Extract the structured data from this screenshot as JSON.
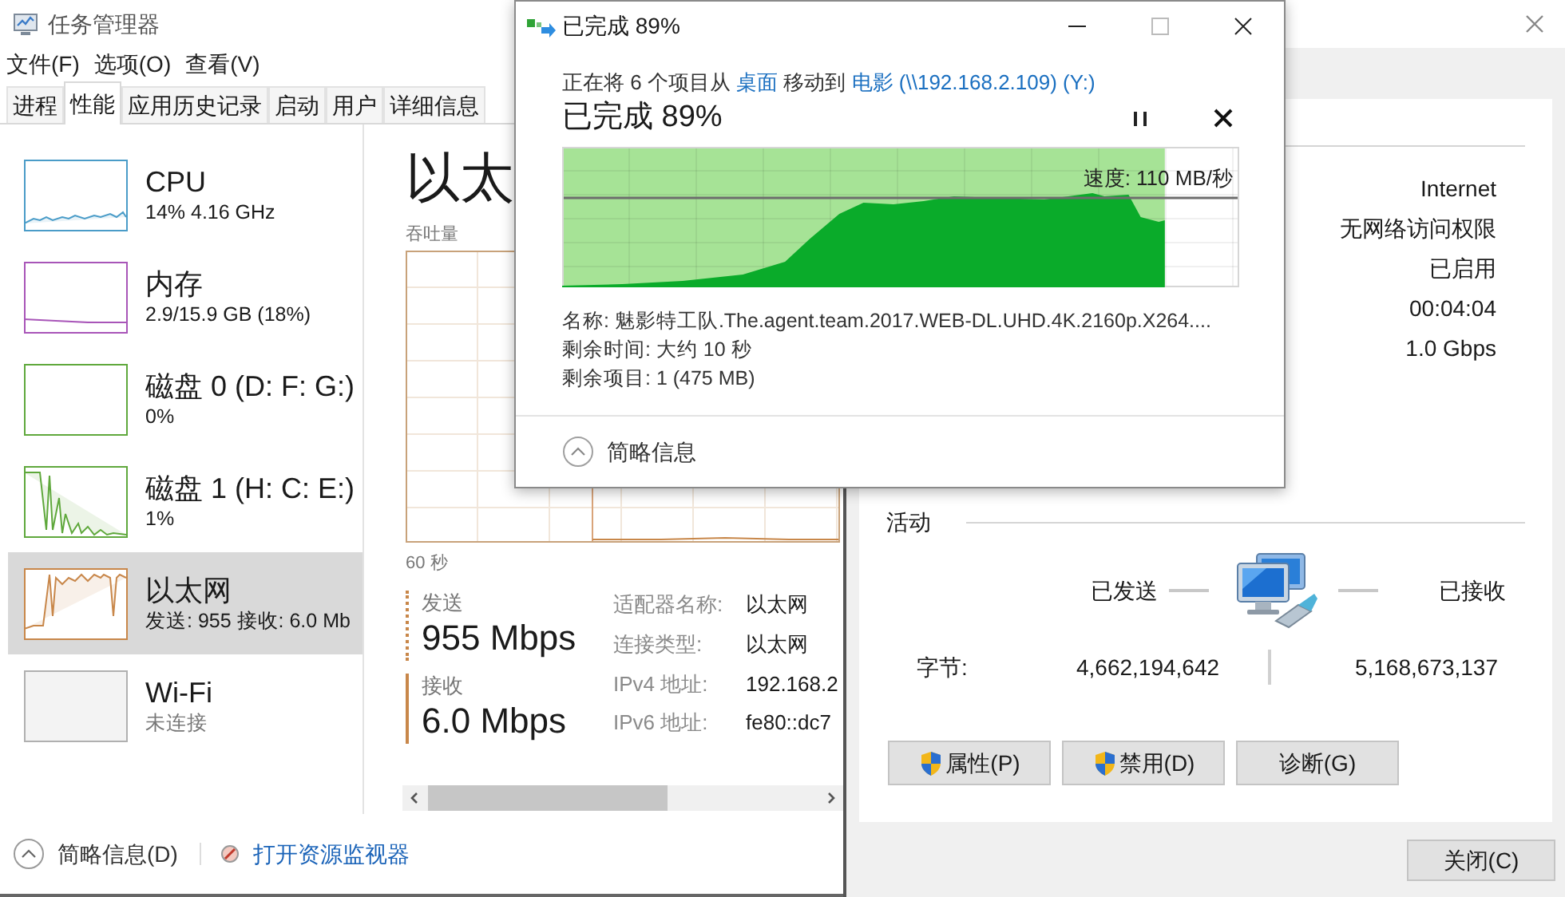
{
  "task_manager": {
    "title": "任务管理器",
    "menu": [
      "文件(F)",
      "选项(O)",
      "查看(V)"
    ],
    "tabs": [
      {
        "label": "进程",
        "selected": false
      },
      {
        "label": "性能",
        "selected": true
      },
      {
        "label": "应用历史记录",
        "selected": false
      },
      {
        "label": "启动",
        "selected": false
      },
      {
        "label": "用户",
        "selected": false
      },
      {
        "label": "详细信息",
        "selected": false
      }
    ],
    "sidebar": {
      "items": [
        {
          "name": "CPU",
          "detail": "14% 4.16 GHz",
          "color": "#4a9cc8",
          "selected": false,
          "disabled": false
        },
        {
          "name": "内存",
          "detail": "2.9/15.9 GB (18%)",
          "color": "#a855b8",
          "selected": false,
          "disabled": false
        },
        {
          "name": "磁盘 0 (D: F: G:)",
          "detail": "0%",
          "color": "#5fa83c",
          "selected": false,
          "disabled": false
        },
        {
          "name": "磁盘 1 (H: C: E:)",
          "detail": "1%",
          "color": "#5fa83c",
          "selected": false,
          "disabled": false
        },
        {
          "name": "以太网",
          "detail": "发送: 955 接收: 6.0 Mb",
          "color": "#c8874a",
          "selected": true,
          "disabled": false
        },
        {
          "name": "Wi-Fi",
          "detail": "未连接",
          "color": "#b0b0b0",
          "selected": false,
          "disabled": true
        }
      ]
    },
    "detail": {
      "heading": "以太",
      "throughput_label": "吞吐量",
      "time_label": "60 秒",
      "send": {
        "label": "发送",
        "value": "955 Mbps"
      },
      "receive": {
        "label": "接收",
        "value": "6.0 Mbps"
      },
      "properties": [
        {
          "label": "适配器名称:",
          "value": "以太网"
        },
        {
          "label": "连接类型:",
          "value": "以太网"
        },
        {
          "label": "IPv4 地址:",
          "value": "192.168.2"
        },
        {
          "label": "IPv6 地址:",
          "value": "fe80::dc7"
        }
      ]
    },
    "footer": {
      "fewer_details": "简略信息(D)",
      "resource_monitor": "打开资源监视器"
    }
  },
  "copy_dialog": {
    "title": "已完成 89%",
    "status": [
      {
        "text": "正在将 6 个项目从 ",
        "link": false
      },
      {
        "text": "桌面",
        "link": true
      },
      {
        "text": " 移动到 ",
        "link": false
      },
      {
        "text": "电影 (\\\\192.168.2.109) (Y:)",
        "link": true
      }
    ],
    "progress_heading": "已完成 89%",
    "level": 0.89,
    "speed": "速度: 110 MB/秒",
    "details": [
      "名称: 魅影特工队.The.agent.team.2017.WEB-DL.UHD.4K.2160p.X264....",
      "剩余时间: 大约 10 秒",
      "剩余项目: 1 (475 MB)"
    ],
    "fewer_details": "简略信息"
  },
  "status_window": {
    "connection_values": [
      "Internet",
      "无网络访问权限",
      "已启用",
      "00:04:04",
      "1.0 Gbps"
    ],
    "activity": {
      "title": "活动",
      "sent_label": "已发送",
      "received_label": "已接收",
      "bytes_label": "字节:",
      "bytes_sent": "4,662,194,642",
      "bytes_received": "5,168,673,137"
    },
    "buttons": [
      {
        "label": "属性(P)",
        "shield": true
      },
      {
        "label": "禁用(D)",
        "shield": true
      },
      {
        "label": "诊断(G)",
        "shield": false
      }
    ],
    "close_button": "关闭(C)"
  }
}
